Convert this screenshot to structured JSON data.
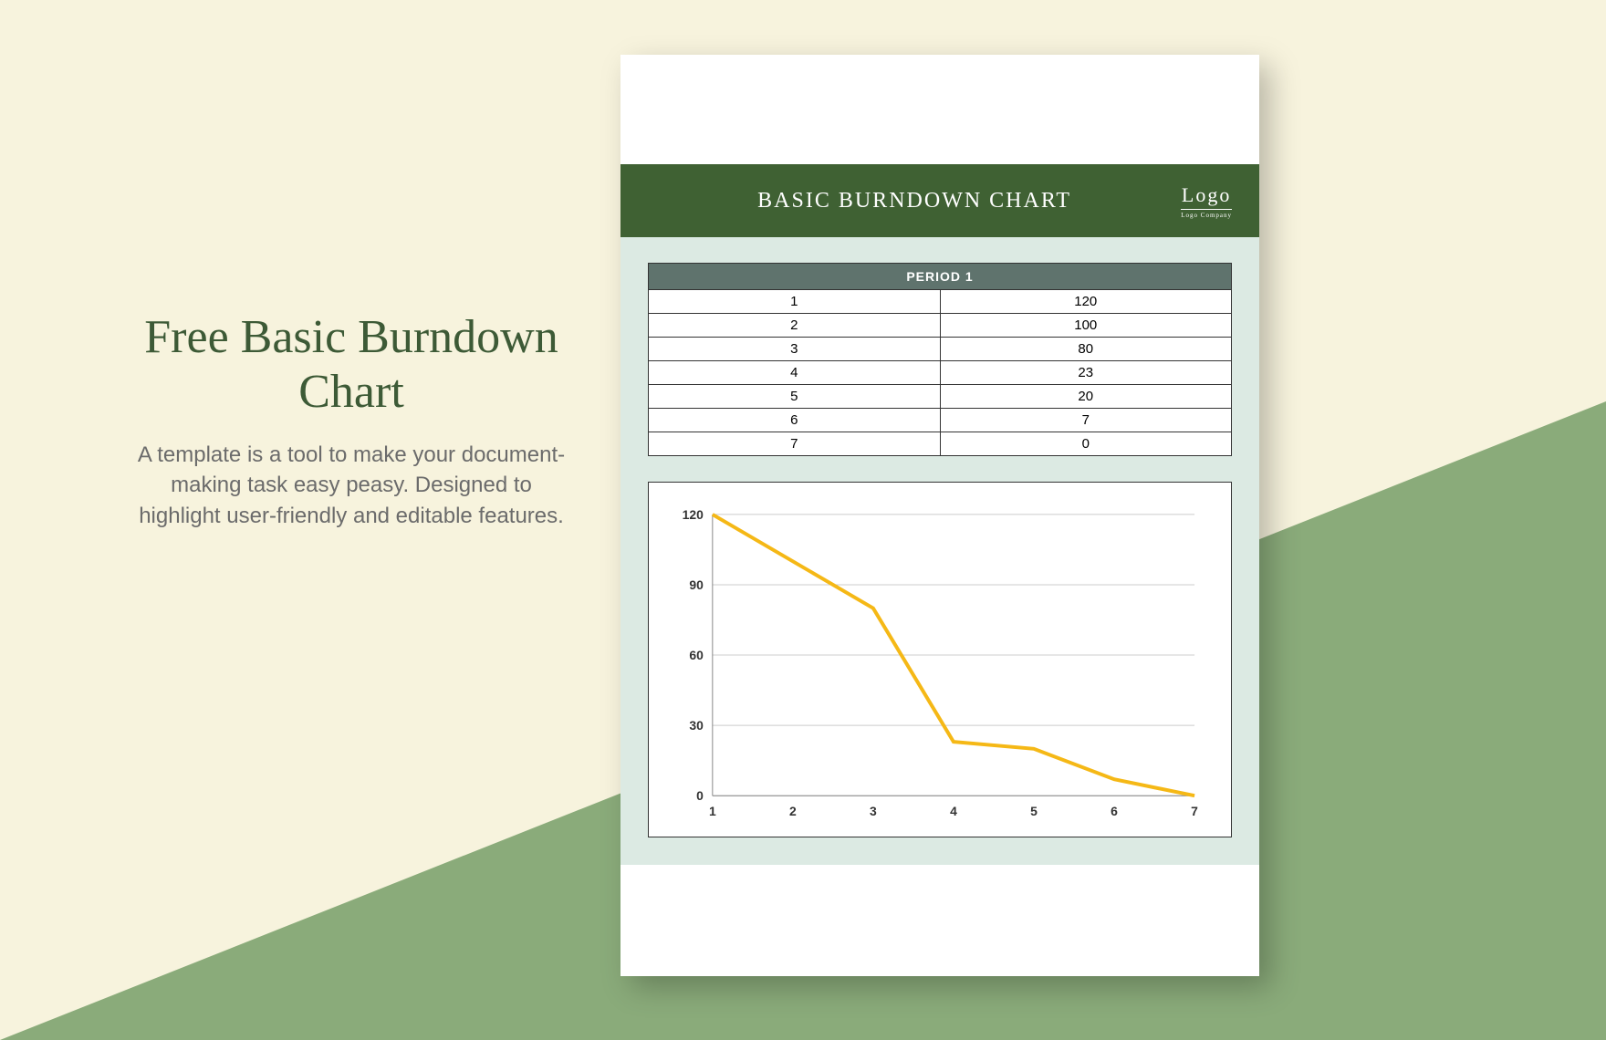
{
  "left": {
    "title": "Free Basic Burndown Chart",
    "description": "A template is a tool to make your document-making task easy peasy. Designed to highlight user-friendly and editable features."
  },
  "document": {
    "banner_title": "BASIC BURNDOWN CHART",
    "logo_text": "Logo",
    "logo_sub": "Logo Company",
    "table_header": "PERIOD 1",
    "rows": [
      {
        "period": "1",
        "value": "120"
      },
      {
        "period": "2",
        "value": "100"
      },
      {
        "period": "3",
        "value": "80"
      },
      {
        "period": "4",
        "value": "23"
      },
      {
        "period": "5",
        "value": "20"
      },
      {
        "period": "6",
        "value": "7"
      },
      {
        "period": "7",
        "value": "0"
      }
    ]
  },
  "chart_data": {
    "type": "line",
    "title": "",
    "xlabel": "",
    "ylabel": "",
    "categories": [
      "1",
      "2",
      "3",
      "4",
      "5",
      "6",
      "7"
    ],
    "values": [
      120,
      100,
      80,
      23,
      20,
      7,
      0
    ],
    "ylim": [
      0,
      120
    ],
    "yticks": [
      0,
      30,
      60,
      90,
      120
    ],
    "line_color": "#f5b816"
  }
}
